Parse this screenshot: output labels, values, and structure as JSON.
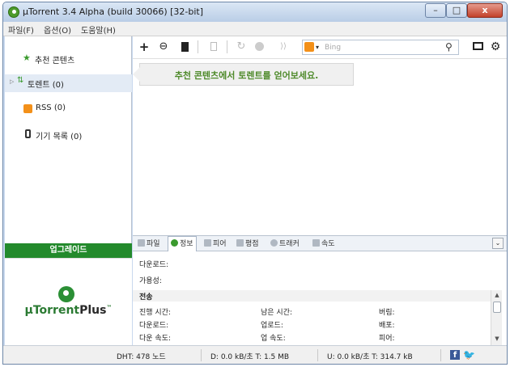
{
  "window": {
    "title": "µTorrent 3.4 Alpha (build 30066) [32-bit]"
  },
  "menu": [
    "파일(F)",
    "옵션(O)",
    "도움말(H)"
  ],
  "sidebar": {
    "items": [
      {
        "label": "추천 콘텐츠",
        "icon": "star-icon"
      },
      {
        "label": "토렌트 (0)",
        "icon": "torrent-arrows-icon"
      },
      {
        "label": "RSS (0)",
        "icon": "rss-icon"
      },
      {
        "label": "기기 목록 (0)",
        "icon": "device-icon"
      }
    ],
    "upgrade_label": "업그레이드",
    "plus_mu": "µTorrent",
    "plus_suffix": "Plus",
    "plus_tm": "™"
  },
  "toolbar": {
    "add": "+",
    "add_url": "⊖",
    "search_provider_arrow": "▾",
    "search_placeholder": "Bing",
    "search_icon": "🔍"
  },
  "main": {
    "banner": "추천 콘텐츠에서 토렌트를 얻어보세요."
  },
  "detail_tabs": [
    "파일",
    "정보",
    "피어",
    "평점",
    "트래커",
    "속도"
  ],
  "detail": {
    "download_label": "다운로드:",
    "availability_label": "가용성:",
    "transfer_header": "전송",
    "fields": {
      "elapsed": "진행 시간:",
      "remaining": "남은 시간:",
      "wasted": "버림:",
      "downloaded": "다운로드:",
      "uploaded": "업로드:",
      "seeds": "배포:",
      "down_speed": "다운 속도:",
      "up_speed": "업 속도:",
      "peers": "피어:"
    }
  },
  "status": {
    "dht": "DHT: 478 노드",
    "down": "D: 0.0 kB/초 T: 1.5 MB",
    "up": "U: 0.0 kB/초 T: 314.7 kB"
  },
  "colors": {
    "accent_green": "#238a2c",
    "banner_text": "#4e8a2a"
  }
}
